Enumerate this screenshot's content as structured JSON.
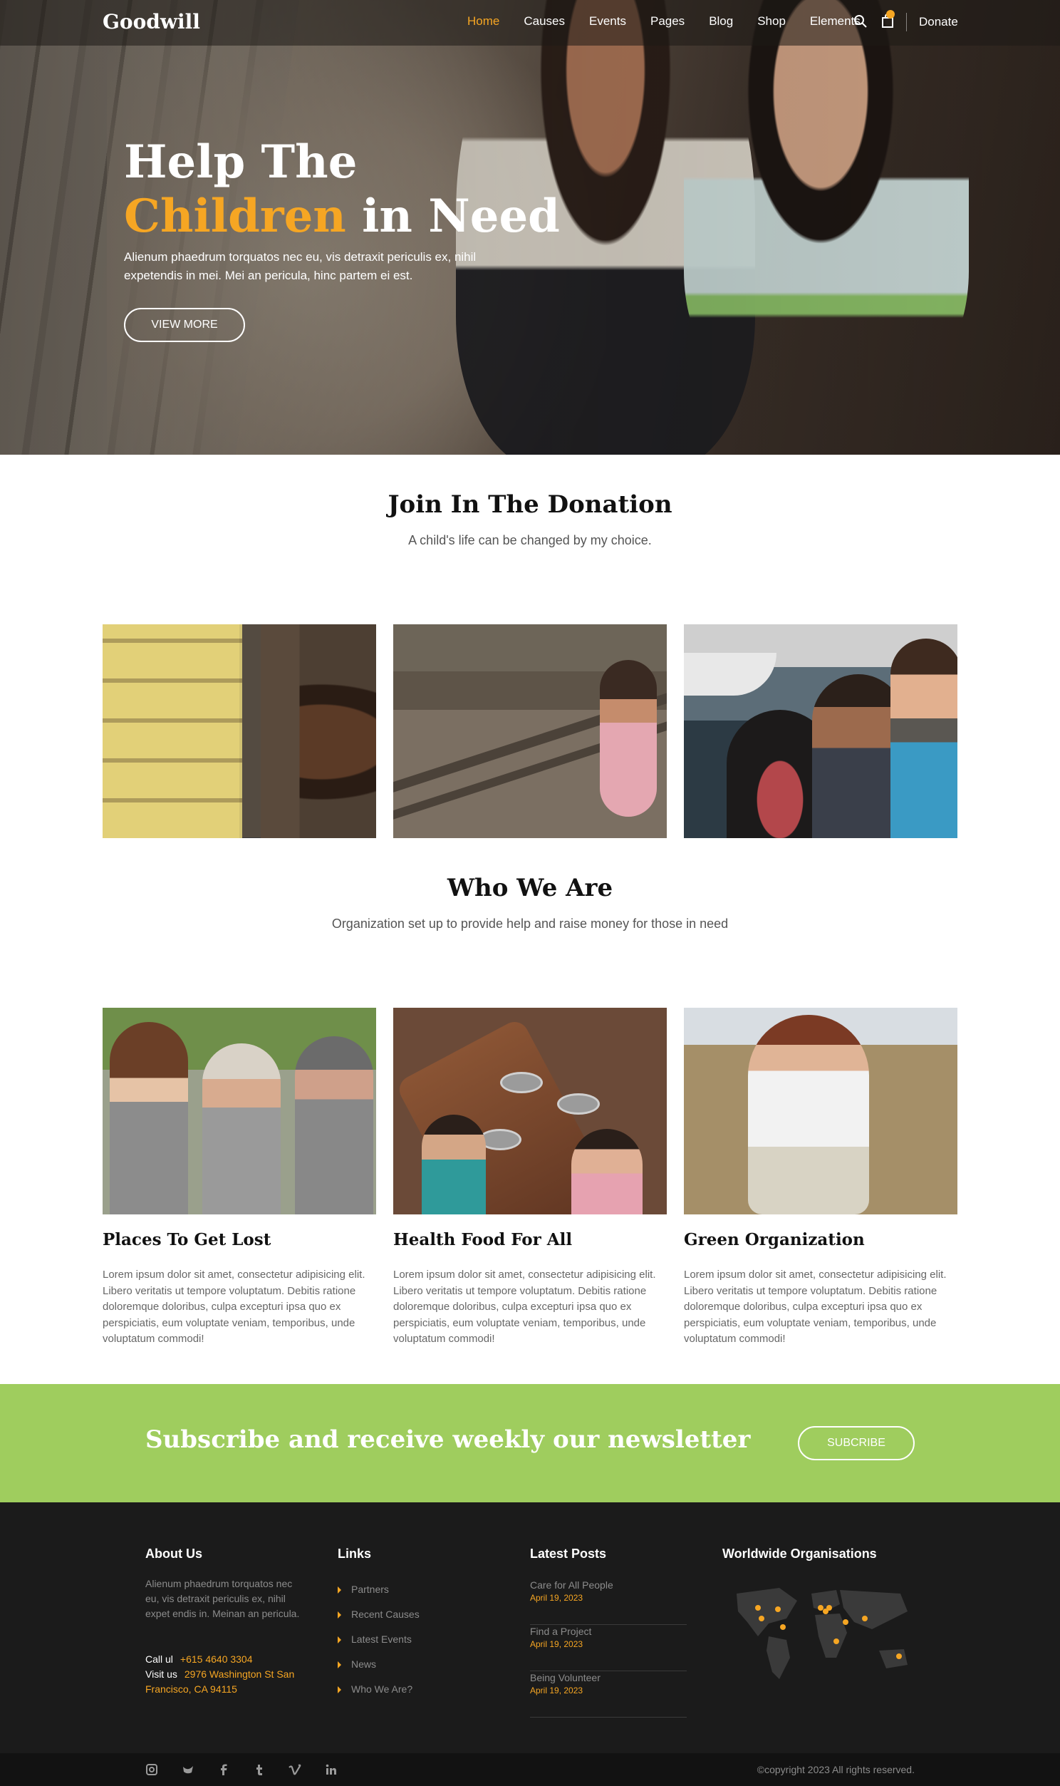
{
  "nav": {
    "logo": "Goodwill",
    "items": [
      "Home",
      "Causes",
      "Events",
      "Pages",
      "Blog",
      "Shop",
      "Elements"
    ],
    "donate": "Donate",
    "cart_count": ""
  },
  "hero": {
    "title_line1": "Help The",
    "title_accent": "Children",
    "title_rest": " in Need",
    "description": "Alienum phaedrum torquatos nec eu, vis detraxit periculis ex, nihil expetendis in mei. Mei an pericula, hinc partem ei est.",
    "button": "VIEW MORE"
  },
  "donation": {
    "title": "Join In The Donation",
    "subtitle": "A child's life can be changed by my choice."
  },
  "who": {
    "title": "Who We Are",
    "subtitle": "Organization set up to provide help and raise money for those in need",
    "cards": [
      {
        "title": "Places To Get Lost",
        "text": "Lorem ipsum dolor sit amet, consectetur adipisicing elit. Libero veritatis ut tempore voluptatum. Debitis ratione doloremque doloribus, culpa excepturi ipsa quo ex perspiciatis, eum voluptate veniam, temporibus, unde voluptatum commodi!"
      },
      {
        "title": "Health Food For All",
        "text": "Lorem ipsum dolor sit amet, consectetur adipisicing elit. Libero veritatis ut tempore voluptatum. Debitis ratione doloremque doloribus, culpa excepturi ipsa quo ex perspiciatis, eum voluptate veniam, temporibus, unde voluptatum commodi!"
      },
      {
        "title": "Green Organization",
        "text": "Lorem ipsum dolor sit amet, consectetur adipisicing elit. Libero veritatis ut tempore voluptatum. Debitis ratione doloremque doloribus, culpa excepturi ipsa quo ex perspiciatis, eum voluptate veniam, temporibus, unde voluptatum commodi!"
      }
    ]
  },
  "newsletter": {
    "title": "Subscribe and receive weekly our newsletter",
    "button": "SUBCRIBE"
  },
  "footer": {
    "about": {
      "heading": "About Us",
      "text": "Alienum phaedrum torquatos nec eu, vis detraxit periculis ex, nihil expet endis in. Meinan an pericula.",
      "call_label": "Call ul",
      "call_value": "+615 4640 3304",
      "visit_label": "Visit us",
      "visit_value": "2976 Washington St San",
      "visit_value2": "Francisco, CA 94115"
    },
    "links": {
      "heading": "Links",
      "items": [
        "Partners",
        "Recent Causes",
        "Latest Events",
        "News",
        "Who We Are?"
      ]
    },
    "posts": {
      "heading": "Latest Posts",
      "items": [
        {
          "title": "Care for All People",
          "date": "April 19, 2023"
        },
        {
          "title": "Find a Project",
          "date": "April 19, 2023"
        },
        {
          "title": "Being Volunteer",
          "date": "April 19, 2023"
        }
      ]
    },
    "world": {
      "heading": "Worldwide Organisations"
    },
    "copyright": "©copyright 2023 All rights reserved.",
    "social": [
      "instagram-icon",
      "twitter-icon",
      "facebook-icon",
      "tumblr-icon",
      "vimeo-icon",
      "linkedin-icon"
    ]
  },
  "colors": {
    "accent": "#f6a623",
    "newsletter_bg": "#9fcd5e",
    "footer_bg": "#1b1b1b"
  }
}
